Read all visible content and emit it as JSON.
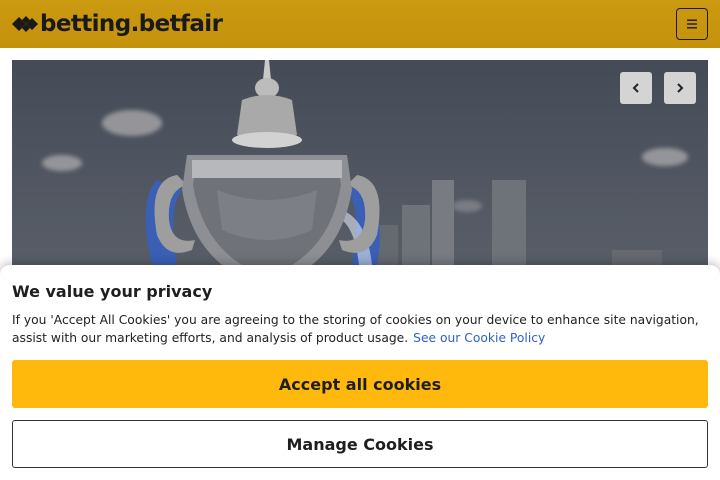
{
  "header": {
    "logo_text": "betting.betfair",
    "logo_icon": "betfair-arrows-icon",
    "menu_icon": "hamburger-menu-icon"
  },
  "hero": {
    "prev_icon": "chevron-left-icon",
    "next_icon": "chevron-right-icon"
  },
  "cookie_banner": {
    "title": "We value your privacy",
    "body": "If you 'Accept All Cookies' you are agreeing to the storing of cookies on your device to enhance site navigation, assist with our marketing efforts, and analysis of product usage.",
    "policy_link": "See our Cookie Policy",
    "accept_label": "Accept all cookies",
    "manage_label": "Manage Cookies"
  },
  "colors": {
    "header_bg": "#c8960f",
    "accept_bg": "#ffb80c",
    "link": "#2f62c7"
  }
}
